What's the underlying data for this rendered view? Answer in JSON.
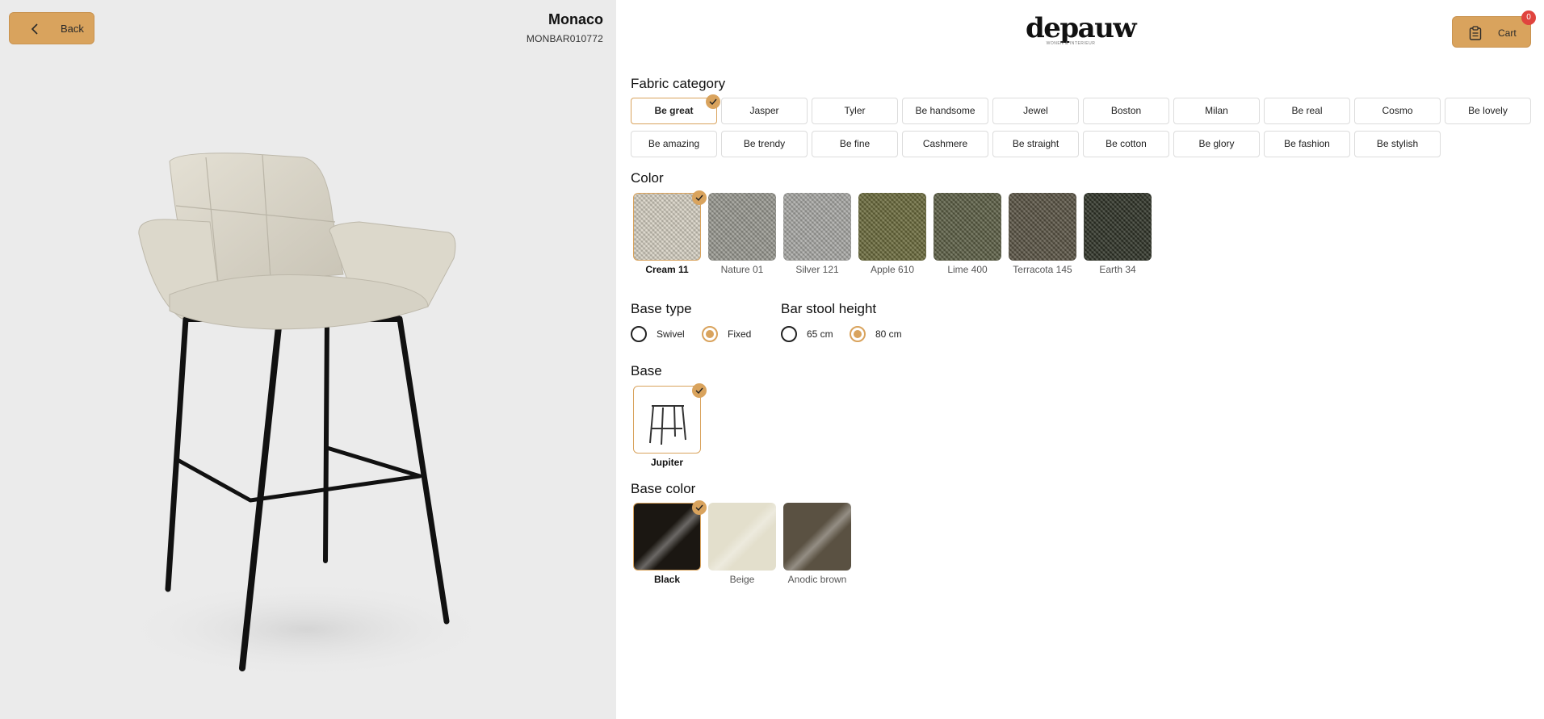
{
  "header": {
    "back_label": "Back",
    "product_name": "Monaco",
    "product_sku": "MONBAR010772",
    "logo_text": "depauw",
    "logo_tagline": "WONEN & INTERIEUR",
    "cart_label": "Cart",
    "cart_count": "0"
  },
  "fabric_category": {
    "title": "Fabric category",
    "selected": "Be great",
    "options": [
      "Be great",
      "Jasper",
      "Tyler",
      "Be handsome",
      "Jewel",
      "Boston",
      "Milan",
      "Be real",
      "Cosmo",
      "Be lovely",
      "Be amazing",
      "Be trendy",
      "Be fine",
      "Cashmere",
      "Be straight",
      "Be cotton",
      "Be glory",
      "Be fashion",
      "Be stylish"
    ]
  },
  "color": {
    "title": "Color",
    "selected": "Cream 11",
    "options": [
      {
        "label": "Cream 11",
        "hex": "#d8d2c4"
      },
      {
        "label": "Nature 01",
        "hex": "#9a9a92"
      },
      {
        "label": "Silver 121",
        "hex": "#a9a9a6"
      },
      {
        "label": "Apple 610",
        "hex": "#6b6b3c"
      },
      {
        "label": "Lime 400",
        "hex": "#5c5f45"
      },
      {
        "label": "Terracota 145",
        "hex": "#5a5444"
      },
      {
        "label": "Earth 34",
        "hex": "#2f3327"
      }
    ]
  },
  "base_type": {
    "title": "Base type",
    "options": [
      "Swivel",
      "Fixed"
    ],
    "selected": "Fixed"
  },
  "bar_stool_height": {
    "title": "Bar stool height",
    "options": [
      "65 cm",
      "80 cm"
    ],
    "selected": "80 cm"
  },
  "base": {
    "title": "Base",
    "selected": "Jupiter",
    "options": [
      "Jupiter"
    ]
  },
  "base_color": {
    "title": "Base color",
    "selected": "Black",
    "options": [
      {
        "label": "Black",
        "hex": "#1b1712"
      },
      {
        "label": "Beige",
        "hex": "#e3dfcc"
      },
      {
        "label": "Anodic brown",
        "hex": "#5a5142"
      }
    ]
  },
  "colors": {
    "accent": "#d9a35d",
    "badge": "#e0443e",
    "left_bg": "#ebebeb"
  }
}
